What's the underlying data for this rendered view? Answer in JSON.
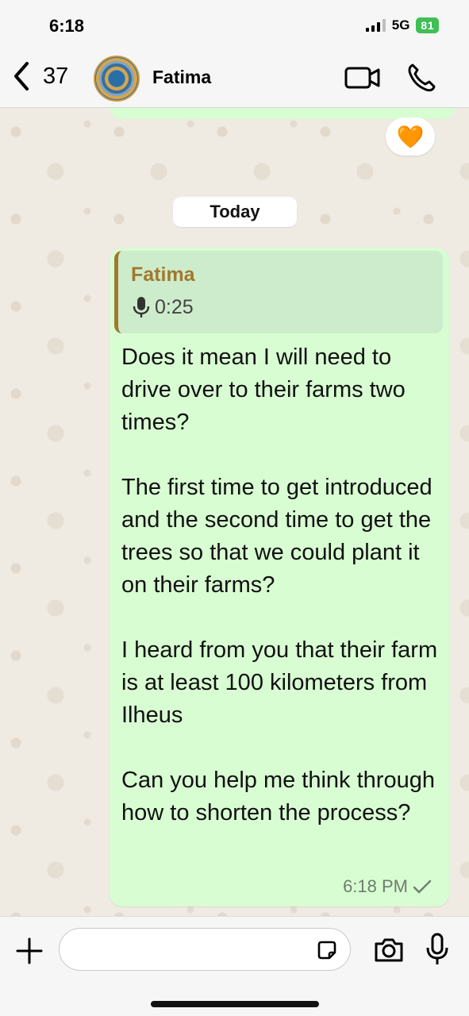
{
  "status_bar": {
    "time": "6:18",
    "network": "5G",
    "battery": "81"
  },
  "header": {
    "back_count": "37",
    "contact_name": "Fatima",
    "icons": [
      "chevron-left-icon",
      "video-call-icon",
      "phone-icon"
    ]
  },
  "chat": {
    "reaction": "🧡",
    "date_label": "Today",
    "message": {
      "quote": {
        "author": "Fatima",
        "audio_duration": "0:25"
      },
      "text": "Does it mean I will need to drive over to their farms two times?\n\nThe first time to get introduced and the second time to get the trees so that we could plant it on their farms?\n\nI heard from you that their farm is at least 100 kilometers from Ilheus\n\nCan you help me think through how to shorten the process?",
      "time": "6:18 PM",
      "status": "sent"
    }
  },
  "composer": {
    "placeholder": "",
    "icons": [
      "plus-icon",
      "sticker-icon",
      "camera-icon",
      "microphone-icon"
    ]
  }
}
